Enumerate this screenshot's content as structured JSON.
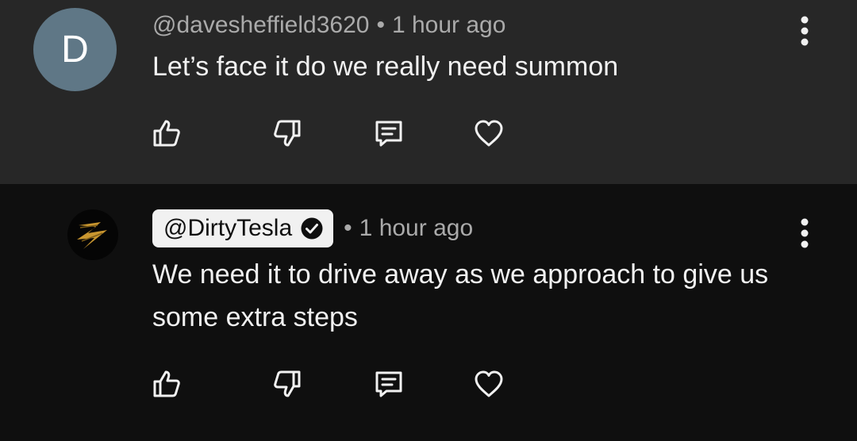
{
  "comments": [
    {
      "avatar_letter": "D",
      "avatar_color": "#5f7786",
      "handle": "@davesheffield3620",
      "separator": "•",
      "time": "1 hour ago",
      "text": "Let’s face it do we really need summon",
      "actions": [
        "like-icon",
        "dislike-icon",
        "reply-icon",
        "heart-icon"
      ]
    },
    {
      "avatar_icon": "lightning-bolt-logo",
      "handle": "@DirtyTesla",
      "verified": true,
      "separator": "•",
      "time": "1 hour ago",
      "text": "We need it to drive away as we approach to give us some extra steps",
      "actions": [
        "like-icon",
        "dislike-icon",
        "reply-icon",
        "heart-icon"
      ]
    }
  ],
  "colors": {
    "top_background": "#272727",
    "reply_background": "#0f0f0f",
    "primary_text": "#f1f1f1",
    "secondary_text": "#aaaaaa",
    "owner_chip": "#f1f1f1",
    "logo_gold": "#c9962f"
  }
}
